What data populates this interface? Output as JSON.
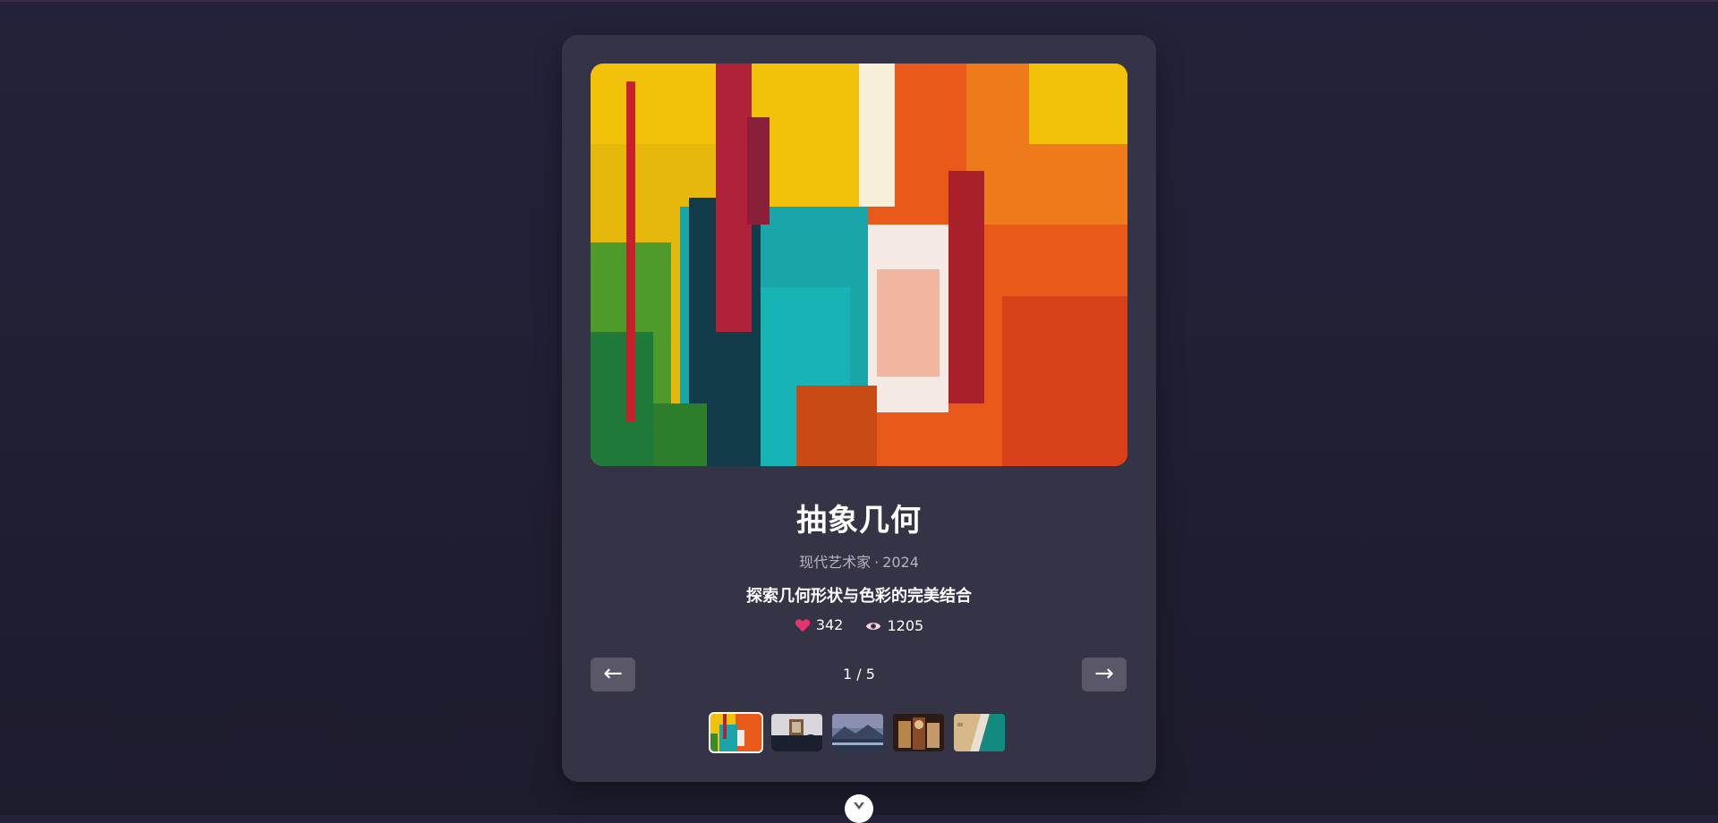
{
  "artwork": {
    "title": "抽象几何",
    "artist": "现代艺术家",
    "separator": "·",
    "year": "2024",
    "description": "探索几何形状与色彩的完美结合",
    "likes": "342",
    "views": "1205"
  },
  "navigation": {
    "prev_label": "←",
    "next_label": "→",
    "counter": "1 / 5"
  },
  "thumbnails": [
    {
      "name": "abstract-painting",
      "active": true
    },
    {
      "name": "framed-art-room",
      "active": false
    },
    {
      "name": "mountain-lake",
      "active": false
    },
    {
      "name": "warm-artwork",
      "active": false
    },
    {
      "name": "coastline-aerial",
      "active": false
    }
  ],
  "icons": {
    "like": "heart-icon",
    "views": "eye-icon",
    "scroll": "chevron-down-icon"
  },
  "colors": {
    "background": "#24223a",
    "card": "#353346",
    "button": "#5a5868",
    "heart": "#e8336e"
  }
}
